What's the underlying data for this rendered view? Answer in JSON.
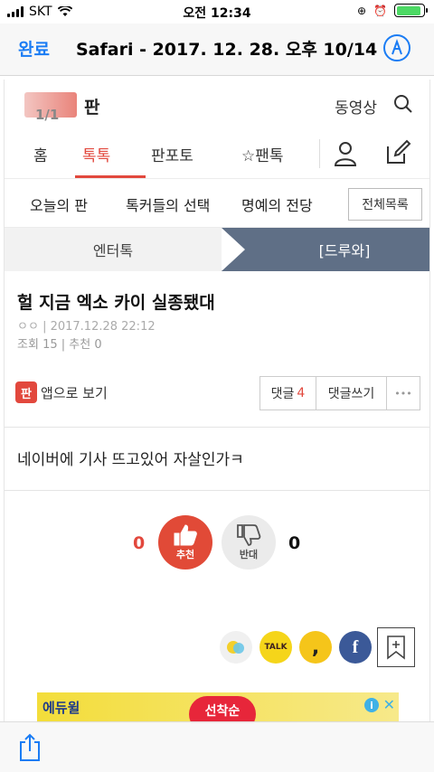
{
  "status_bar": {
    "carrier": "SKT",
    "time": "오전 12:34",
    "battery_level": 0.9
  },
  "viewer": {
    "done_label": "완료",
    "title": "Safari - 2017. 12. 28. 오후 10/14",
    "markup_icon": "markup-pen-icon"
  },
  "site": {
    "page_badge": "1/1",
    "name": "판",
    "video_link": "동영상",
    "tabs": [
      "홈",
      "톡톡",
      "판포토",
      "☆팬톡"
    ],
    "active_tab_index": 1,
    "sub_nav": [
      "오늘의 판",
      "톡커들의 선택",
      "명예의 전당"
    ],
    "all_list_label": "전체목록",
    "board_tabs": [
      "엔터톡",
      "[드루와]"
    ]
  },
  "post": {
    "title": "헐 지금 엑소 카이 실종됐대",
    "author": "ㅇㅇ",
    "date": "2017.12.28 22:12",
    "views_label": "조회",
    "views": "15",
    "recommend_label": "추천",
    "recommend": "0",
    "app_view_label": "앱으로 보기",
    "comment_label": "댓글",
    "comment_count": "4",
    "write_comment_label": "댓글쓰기",
    "more_label": "•••",
    "body": "네이버에 기사 뜨고있어 자살인가ㅋ",
    "upvote_count": "0",
    "upvote_label": "추천",
    "downvote_count": "0",
    "downvote_label": "반대"
  },
  "share": {
    "kakaotalk_label": "TALK"
  },
  "ad": {
    "brand": "에듀윌",
    "badge": "선착순"
  },
  "colors": {
    "accent": "#e2483d",
    "link_blue": "#1a7cf4",
    "board_active": "#5f6f86"
  }
}
